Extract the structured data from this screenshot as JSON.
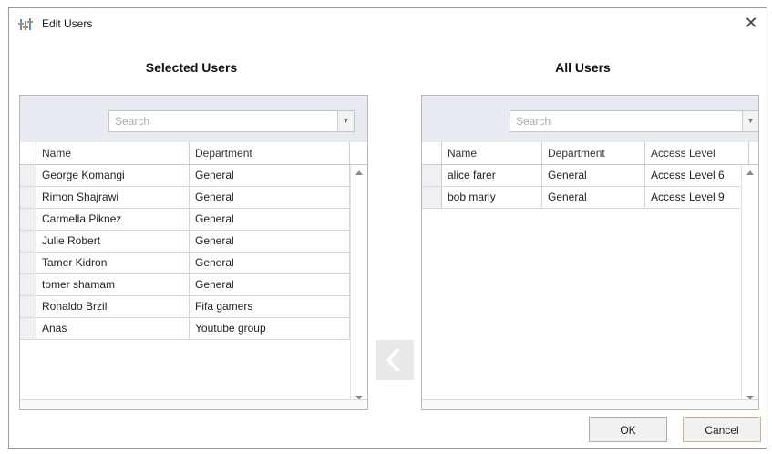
{
  "window": {
    "title": "Edit Users",
    "close_glyph": "✕"
  },
  "left_panel": {
    "title": "Selected Users",
    "search_placeholder": "Search",
    "columns": [
      "Name",
      "Department"
    ],
    "rows": [
      [
        "George Komangi",
        "General"
      ],
      [
        "Rimon Shajrawi",
        "General"
      ],
      [
        "Carmella Piknez",
        "General"
      ],
      [
        "Julie Robert",
        "General"
      ],
      [
        "Tamer Kidron",
        "General"
      ],
      [
        "tomer shamam",
        "General"
      ],
      [
        "Ronaldo Brzil",
        "Fifa gamers"
      ],
      [
        "Anas",
        "Youtube group"
      ]
    ]
  },
  "right_panel": {
    "title": "All Users",
    "search_placeholder": "Search",
    "columns": [
      "Name",
      "Department",
      "Access Level"
    ],
    "rows": [
      [
        "alice farer",
        "General",
        "Access Level 6"
      ],
      [
        "bob marly",
        "General",
        "Access Level 9"
      ]
    ]
  },
  "move_button_icon": "chevron-left-icon",
  "buttons": {
    "ok": "OK",
    "cancel": "Cancel"
  },
  "colors": {
    "grid_header_bg": "#e7ebf1",
    "cancel_border": "#d9b47a"
  }
}
